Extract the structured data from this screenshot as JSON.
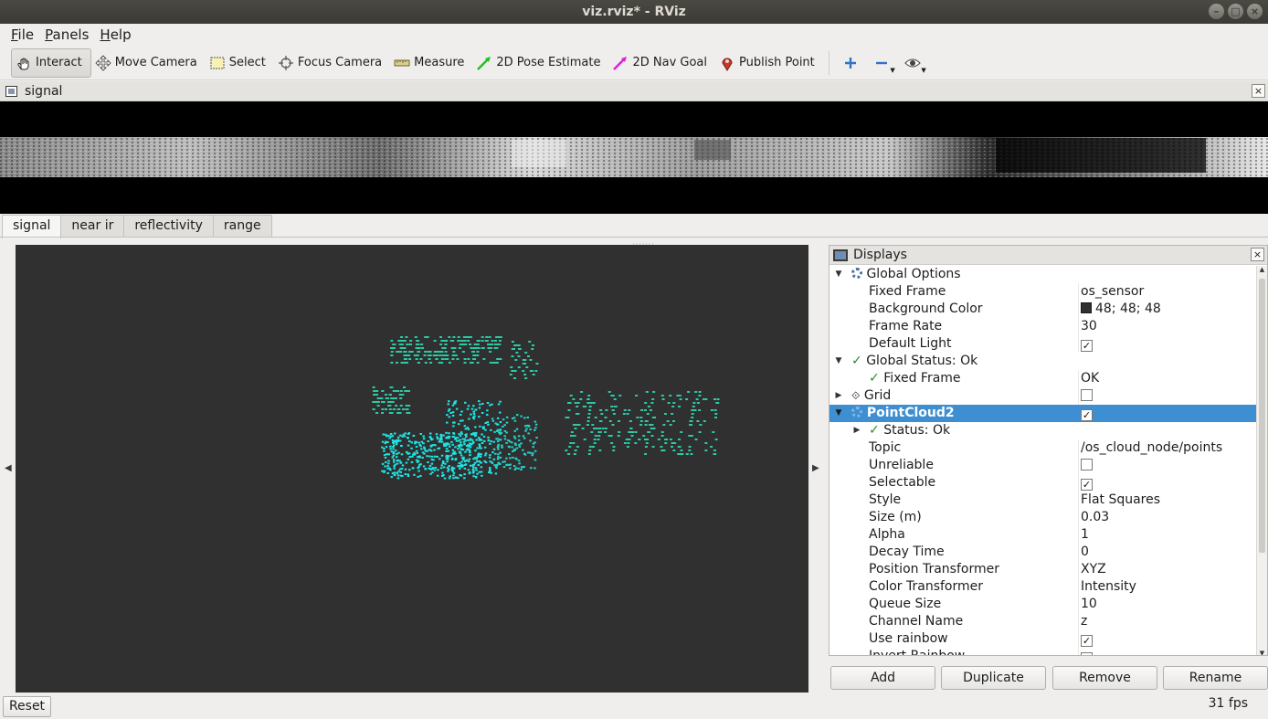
{
  "window": {
    "title": "viz.rviz* - RViz",
    "buttons": [
      "–",
      "□",
      "×"
    ]
  },
  "menu": [
    {
      "mnemonic": "F",
      "rest": "ile"
    },
    {
      "mnemonic": "P",
      "rest": "anels"
    },
    {
      "mnemonic": "H",
      "rest": "elp"
    }
  ],
  "toolbar": {
    "interact": "Interact",
    "move_camera": "Move Camera",
    "select": "Select",
    "focus_camera": "Focus Camera",
    "measure": "Measure",
    "pose_estimate": "2D Pose Estimate",
    "nav_goal": "2D Nav Goal",
    "publish_point": "Publish Point",
    "icons": [
      "plus-icon",
      "minus-icon",
      "eye-icon"
    ]
  },
  "signal_panel": {
    "title": "signal",
    "close": "×",
    "tabs": [
      "signal",
      "near ir",
      "reflectivity",
      "range"
    ],
    "selected_tab": "signal"
  },
  "displays": {
    "title": "Displays",
    "close": "×",
    "rows": {
      "global_options": "Global Options",
      "fixed_frame_label": "Fixed Frame",
      "fixed_frame_value": "os_sensor",
      "bg_color_label": "Background Color",
      "bg_color_value": "48; 48; 48",
      "frame_rate_label": "Frame Rate",
      "frame_rate_value": "30",
      "default_light_label": "Default Light",
      "global_status": "Global Status: Ok",
      "fixed_frame_status_label": "Fixed Frame",
      "fixed_frame_status_value": "OK",
      "grid": "Grid",
      "pointcloud": "PointCloud2",
      "status_ok": "Status: Ok",
      "topic_label": "Topic",
      "topic_value": "/os_cloud_node/points",
      "unreliable_label": "Unreliable",
      "selectable_label": "Selectable",
      "style_label": "Style",
      "style_value": "Flat Squares",
      "size_label": "Size (m)",
      "size_value": "0.03",
      "alpha_label": "Alpha",
      "alpha_value": "1",
      "decay_label": "Decay Time",
      "decay_value": "0",
      "pos_transformer_label": "Position Transformer",
      "pos_transformer_value": "XYZ",
      "color_transformer_label": "Color Transformer",
      "color_transformer_value": "Intensity",
      "queue_size_label": "Queue Size",
      "queue_size_value": "10",
      "channel_label": "Channel Name",
      "channel_value": "z",
      "use_rainbow_label": "Use rainbow",
      "invert_rainbow_label": "Invert Rainbow"
    },
    "checks": {
      "default_light": true,
      "grid": false,
      "pointcloud": true,
      "unreliable": false,
      "selectable": true,
      "use_rainbow": true,
      "invert_rainbow": true
    },
    "buttons": {
      "add": "Add",
      "duplicate": "Duplicate",
      "remove": "Remove",
      "rename": "Rename"
    }
  },
  "colors": {
    "view_background": "#303030",
    "selection": "#3d8fd2",
    "point_cyan": "#1ee6e6",
    "point_teal": "#2ec9a6"
  },
  "status": {
    "reset": "Reset",
    "fps": "31 fps"
  }
}
